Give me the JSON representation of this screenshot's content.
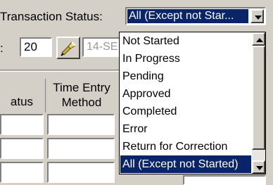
{
  "transaction_status": {
    "label": "Transaction Status:",
    "selected_value": "All (Except not Star..."
  },
  "row2": {
    "label_fragment": ":",
    "number_value": "20",
    "date_value": "14-SE"
  },
  "grid": {
    "headers": {
      "status_fragment": "atus",
      "time_entry_line1": "Time Entry",
      "time_entry_line2": "Method"
    }
  },
  "dropdown": {
    "options": [
      "Not Started",
      "In Progress",
      "Pending",
      "Approved",
      "Completed",
      "Error",
      "Return for Correction",
      "All (Except not Started)"
    ],
    "selected_index": 7
  },
  "icons": {
    "lookup": "flashlight-icon",
    "combo_arrow": "chevron-down-icon",
    "scroll_up": "scroll-up-arrow-icon",
    "scroll_down": "scroll-down-arrow-icon"
  },
  "colors": {
    "selection": "#0a246a",
    "window_face": "#d4d0c8"
  }
}
